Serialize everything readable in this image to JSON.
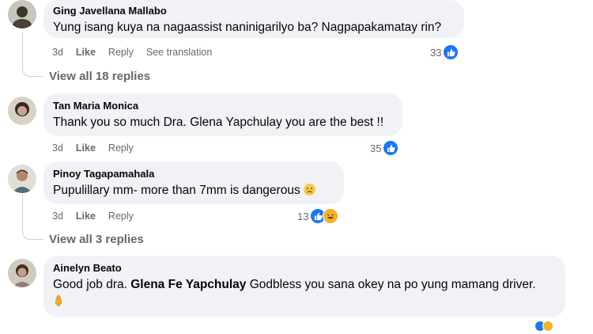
{
  "comments": [
    {
      "author": "Ging Javellana Mallabo",
      "text": "Yung isang kuya na nagaassist naninigarilyo ba? Nagpapakamatay rin?",
      "time": "3d",
      "like": "Like",
      "reply": "Reply",
      "translate": "See translation",
      "reaction_count": "33",
      "view_replies": "View all 18 replies"
    },
    {
      "author": "Tan Maria Monica",
      "text": "Thank you so much Dra. Glena Yapchulay you are the best !!",
      "time": "3d",
      "like": "Like",
      "reply": "Reply",
      "reaction_count": "35"
    },
    {
      "author": "Pinoy Tagapamahala",
      "text": "Pupulillary mm- more than 7mm is dangerous",
      "time": "3d",
      "like": "Like",
      "reply": "Reply",
      "reaction_count": "13",
      "view_replies": "View all 3 replies"
    },
    {
      "author": "Ainelyn Beato",
      "text_before": "Good job dra. ",
      "mention": "Glena Fe Yapchulay",
      "text_after": " Godbless you sana okey na po yung mamang driver."
    }
  ],
  "icons": {
    "like": "like-reaction-icon",
    "haha": "haha-reaction-icon",
    "sad": "sad-emoji",
    "pray": "folded-hands-emoji"
  },
  "colors": {
    "bubble": "#f0f2f5",
    "meta": "#65676b",
    "like_blue": "#1877f2",
    "haha_yellow": "#f7b125"
  }
}
